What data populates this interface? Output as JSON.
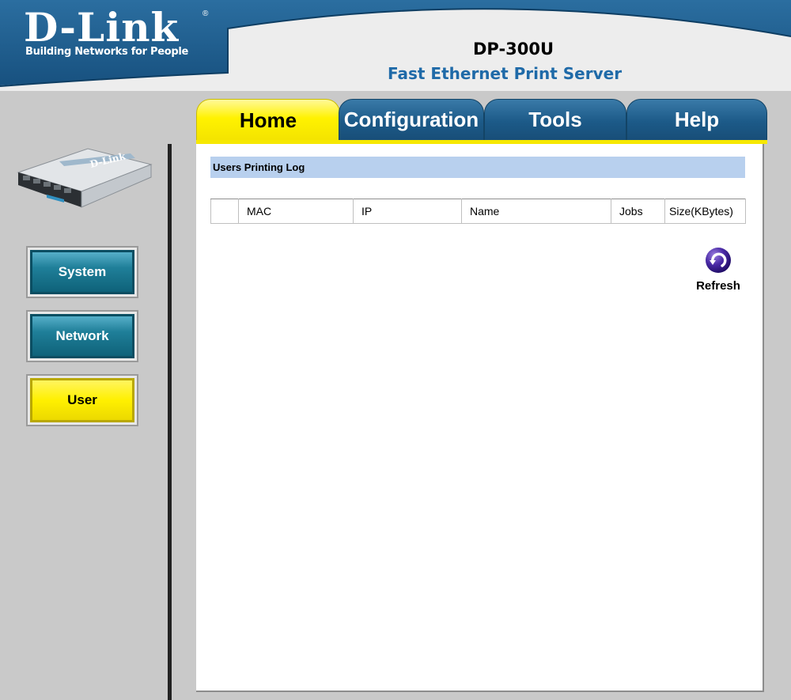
{
  "header": {
    "brand": "D-Link",
    "brand_mark": "®",
    "tagline": "Building Networks for People",
    "model": "DP-300U",
    "product": "Fast Ethernet Print Server"
  },
  "tabs": [
    {
      "label": "Home",
      "active": true
    },
    {
      "label": "Configuration",
      "active": false
    },
    {
      "label": "Tools",
      "active": false
    },
    {
      "label": "Help",
      "active": false
    }
  ],
  "sidebar": {
    "device_image": "print-server-device-icon",
    "items": [
      {
        "label": "System",
        "active": false
      },
      {
        "label": "Network",
        "active": false
      },
      {
        "label": "User",
        "active": true
      }
    ]
  },
  "main": {
    "section_title": "Users Printing Log",
    "table": {
      "columns": [
        "",
        "MAC",
        "IP",
        "Name",
        "Jobs",
        "Size(KBytes)"
      ],
      "rows": []
    },
    "refresh_label": "Refresh",
    "refresh_icon": "refresh-icon"
  },
  "colors": {
    "header_blue": "#1d5f93",
    "tab_active": "#fff200",
    "tab_inactive": "#1c5a88",
    "sidebar_button": "#1f7f99",
    "sidebar_active": "#fff000",
    "section_bar": "#b8d0ee",
    "product_text": "#1f6aa8"
  }
}
